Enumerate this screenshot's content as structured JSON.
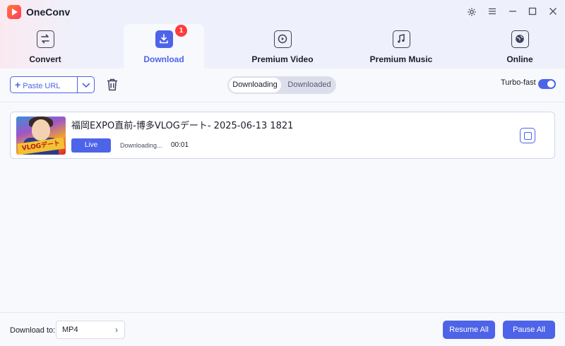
{
  "app": {
    "title": "OneConv"
  },
  "window_controls": [
    {
      "name": "settings-icon"
    },
    {
      "name": "menu-icon"
    },
    {
      "name": "minimize-icon"
    },
    {
      "name": "maximize-icon"
    },
    {
      "name": "close-icon"
    }
  ],
  "tabs": [
    {
      "label": "Convert",
      "icon": "convert-icon"
    },
    {
      "label": "Download",
      "icon": "download-icon",
      "badge": "1",
      "active": true
    },
    {
      "label": "Premium Video",
      "icon": "premium-video-icon"
    },
    {
      "label": "Premium Music",
      "icon": "premium-music-icon"
    },
    {
      "label": "Online",
      "icon": "online-icon"
    }
  ],
  "toolbar": {
    "paste_url_label": "Paste URL",
    "segment": {
      "downloading": "Downloading",
      "downloaded": "Downloaded"
    },
    "turbo_label": "Turbo-fast",
    "turbo_enabled": true
  },
  "items": [
    {
      "title": "福岡EXPO直前-博多VLOGデート- 2025-06-13 1821",
      "thumbnail_text": "VLOGデート",
      "badge_label": "Live",
      "status": "Downloading...",
      "elapsed": "00:01"
    }
  ],
  "footer": {
    "download_to_label": "Download to:",
    "format_value": "MP4",
    "resume_all_label": "Resume All",
    "pause_all_label": "Pause All"
  },
  "colors": {
    "accent": "#4d64e8",
    "badge": "#ff3b3b"
  }
}
